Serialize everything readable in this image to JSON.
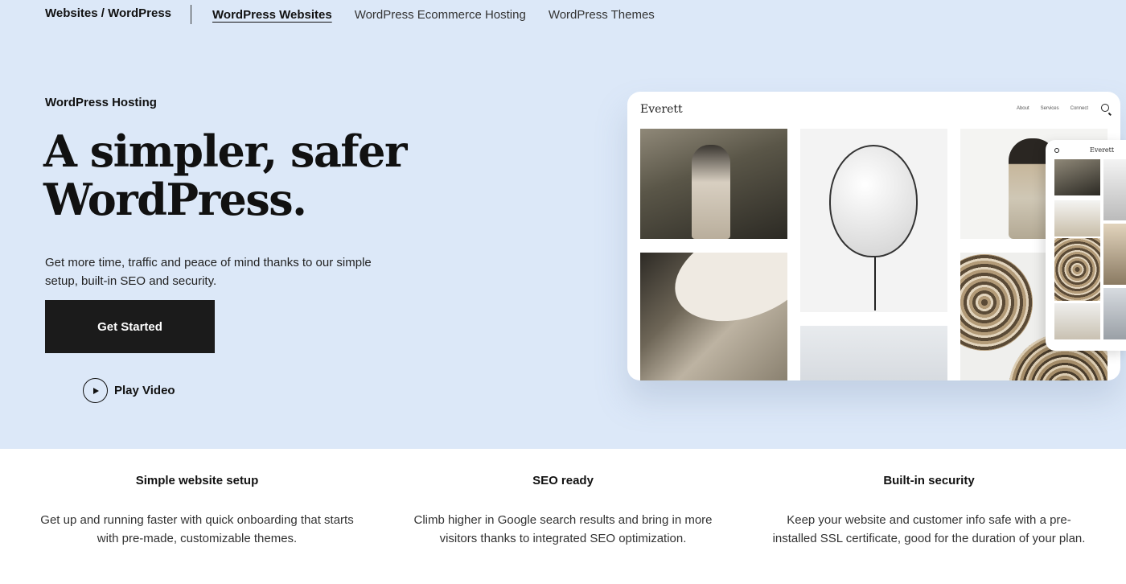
{
  "subnav": {
    "breadcrumb": "Websites / WordPress",
    "links": [
      {
        "label": "WordPress Websites"
      },
      {
        "label": "WordPress Ecommerce Hosting"
      },
      {
        "label": "WordPress Themes"
      }
    ]
  },
  "hero": {
    "eyebrow": "WordPress Hosting",
    "headline_line1": "A simpler, safer",
    "headline_line2": "WordPress.",
    "lede": "Get more time, traffic and peace of mind thanks to our simple setup, built-in SEO and security.",
    "cta_label": "Get Started",
    "play_label": "Play Video",
    "play_icon": "play-icon"
  },
  "mockup": {
    "brand": "Everett",
    "nav": [
      "About",
      "Services",
      "Connect"
    ],
    "search_icon": "search-icon",
    "phone_brand": "Everett"
  },
  "features": [
    {
      "title": "Simple website setup",
      "body": "Get up and running faster with quick onboarding that starts with pre-made, customizable themes."
    },
    {
      "title": "SEO ready",
      "body": "Climb higher in Google search results and bring in more visitors thanks to integrated SEO optimization."
    },
    {
      "title": "Built-in security",
      "body": "Keep your website and customer info safe with a pre-installed SSL certificate, good for the duration of your plan."
    }
  ],
  "colors": {
    "hero_background": "#dce8f8",
    "cta_background": "#1b1b1b"
  }
}
